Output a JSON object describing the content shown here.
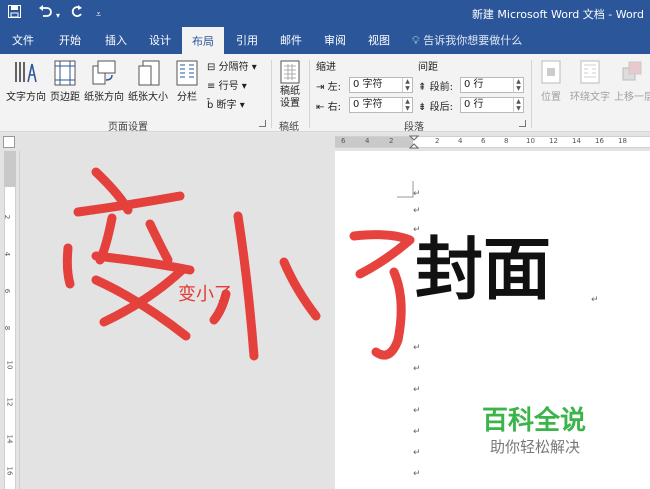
{
  "titlebar": {
    "save_icon": "save-icon",
    "undo_icon": "undo-icon",
    "redo_icon": "redo-icon",
    "customize_icon": "customize-qat-icon",
    "title": "新建 Microsoft Word 文档 - Word"
  },
  "tabs": [
    "文件",
    "开始",
    "插入",
    "设计",
    "布局",
    "引用",
    "邮件",
    "审阅",
    "视图"
  ],
  "active_tab": "布局",
  "tell_me": "告诉我你想要做什么",
  "ribbon": {
    "page_setup": {
      "text_direction": "文字方向",
      "margins": "页边距",
      "orientation": "纸张方向",
      "size": "纸张大小",
      "columns": "分栏",
      "breaks": "分隔符",
      "line_numbers": "行号",
      "hyphenation": "断字",
      "label": "页面设置"
    },
    "manuscript": {
      "button": "稿纸\n设置",
      "label": "稿纸"
    },
    "paragraph": {
      "indent_label": "缩进",
      "spacing_label": "间距",
      "left_label": "左:",
      "left_value": "0 字符",
      "right_label": "右:",
      "right_value": "0 字符",
      "before_label": "段前:",
      "before_value": "0 行",
      "after_label": "段后:",
      "after_value": "0 行",
      "label": "段落"
    },
    "arrange": {
      "position": "位置",
      "wrap_text": "环绕文字",
      "bring_forward": "上移一层"
    }
  },
  "rulers": {
    "h_left": [
      "6",
      "4",
      "2"
    ],
    "h_right": [
      "2",
      "4",
      "6",
      "8",
      "10",
      "12",
      "14",
      "16",
      "18"
    ],
    "v": [
      "2",
      "4",
      "6",
      "8",
      "10",
      "12",
      "14",
      "16"
    ]
  },
  "document": {
    "heading": "封面",
    "annotation_label": "变小了",
    "handwritten": "变小了"
  },
  "watermark": {
    "line1": "百科全说",
    "line2": "助你轻松解决"
  },
  "colors": {
    "accent": "#2b579a",
    "ink": "#e53935",
    "watermark": "#3bb54a"
  }
}
